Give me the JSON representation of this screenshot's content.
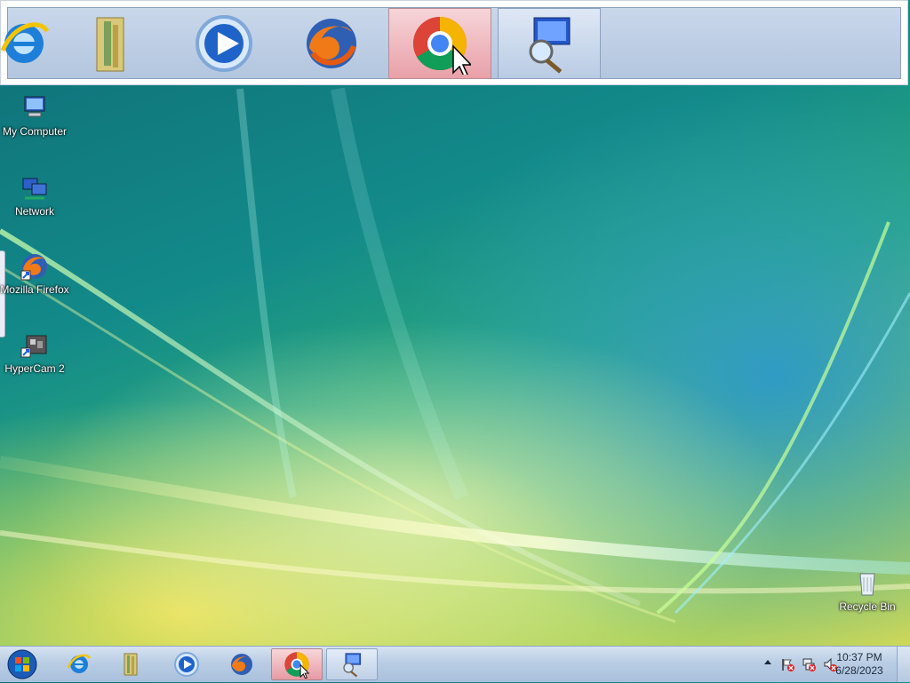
{
  "desktop": {
    "icons": [
      {
        "label": "My Computer",
        "icon": "computer-icon"
      },
      {
        "label": "Network",
        "icon": "network-icon"
      },
      {
        "label": "Mozilla Firefox",
        "icon": "firefox-icon"
      },
      {
        "label": "HyperCam 2",
        "icon": "hypercam-icon"
      },
      {
        "label": "Recycle Bin",
        "icon": "recycle-bin-icon"
      }
    ]
  },
  "magnifier": {
    "items": [
      {
        "icon": "internet-explorer-icon"
      },
      {
        "icon": "library-folder-icon"
      },
      {
        "icon": "media-player-icon"
      },
      {
        "icon": "firefox-icon"
      },
      {
        "icon": "chrome-icon",
        "state": "active"
      },
      {
        "icon": "magnifier-icon",
        "state": "open"
      }
    ]
  },
  "taskbar": {
    "start": {
      "icon": "windows-start-icon"
    },
    "pinned": [
      {
        "icon": "internet-explorer-icon"
      },
      {
        "icon": "library-folder-icon"
      },
      {
        "icon": "media-player-icon"
      },
      {
        "icon": "firefox-icon"
      },
      {
        "icon": "chrome-icon",
        "state": "active"
      },
      {
        "icon": "magnifier-icon",
        "state": "open"
      }
    ],
    "tray": {
      "icons": [
        "show-hidden-icons-arrow",
        "action-center-flag-icon",
        "network-disconnected-icon",
        "volume-muted-icon"
      ],
      "time": "10:37 PM",
      "date": "6/28/2023"
    }
  },
  "colors": {
    "taskbar_active": "#e79aa3",
    "taskbar_bg": "#b9cde4"
  }
}
